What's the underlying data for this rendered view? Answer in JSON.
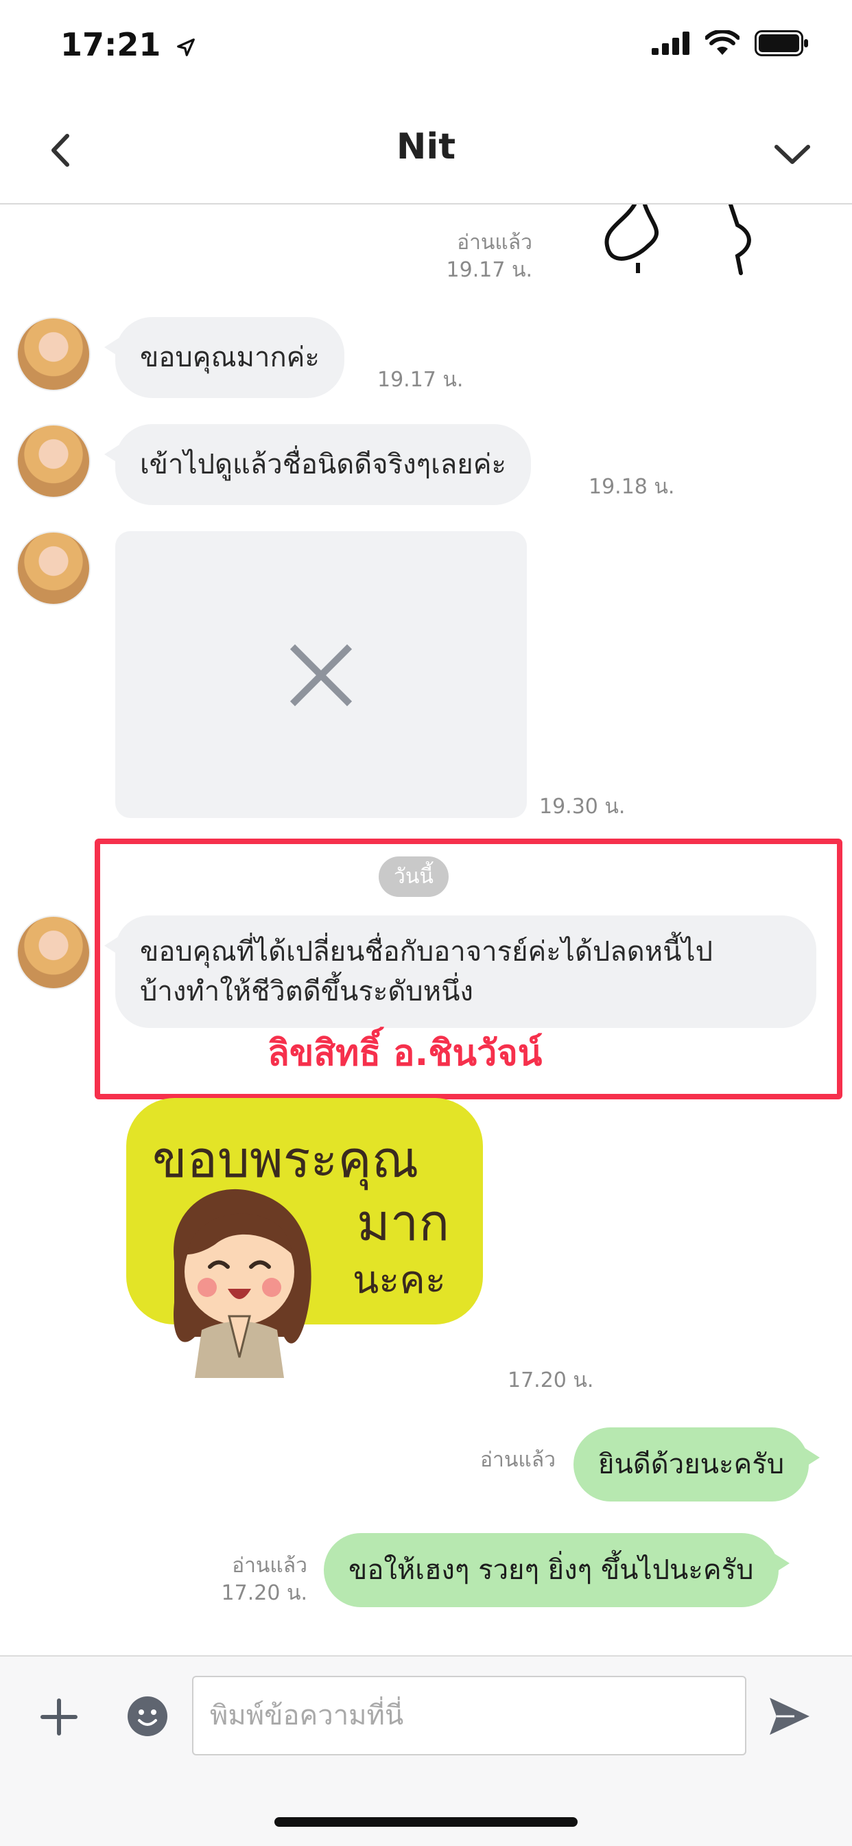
{
  "status_bar": {
    "time": "17:21"
  },
  "header": {
    "title": "Nit"
  },
  "messages": {
    "top_read": "อ่านแล้ว",
    "top_time": "19.17 น.",
    "m1_text": "ขอบคุณมากค่ะ",
    "m1_time": "19.17 น.",
    "m2_text": "เข้าไปดูแล้วชื่อนิดดีจริงๆเลยค่ะ",
    "m2_time": "19.18 น.",
    "m3_time": "19.30 น.",
    "day_separator": "วันนี้",
    "m4_line1": "ขอบคุณที่ได้เปลี่ยนชื่อกับอาจารย์ค่ะได้ปลดหนี้ไป",
    "m4_line2": "บ้างทำให้ชีวิตดีขึ้นระดับหนึ่ง",
    "watermark": "ลิขสิทธิ์  อ.ชินวัจน์",
    "sticker_line1": "ขอบพระคุณ",
    "sticker_line2": "มาก",
    "sticker_line3": "นะคะ",
    "sticker_time": "17.20 น.",
    "out1_read": "อ่านแล้ว",
    "out1_text": "ยินดีด้วยนะครับ",
    "out2_read": "อ่านแล้ว",
    "out2_time": "17.20 น.",
    "out2_text": "ขอให้เฮงๆ รวยๆ ยิ่งๆ ขึ้นไปนะครับ"
  },
  "input": {
    "placeholder": "พิมพ์ข้อความที่นี่"
  },
  "colors": {
    "accent_red": "#f6304c",
    "outgoing_bubble": "#b7e8b0",
    "incoming_bubble": "#f0f1f3",
    "sticker_bg": "#e3e427"
  }
}
